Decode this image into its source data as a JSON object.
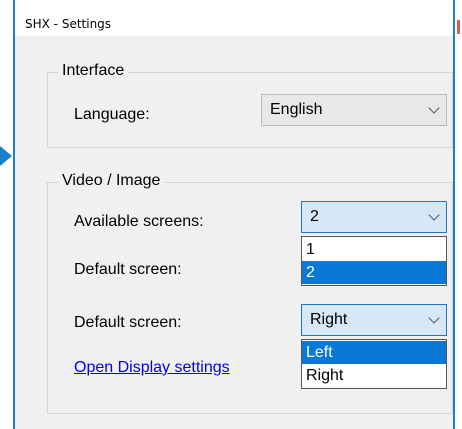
{
  "window": {
    "title": "SHX - Settings"
  },
  "interface_group": {
    "title": "Interface",
    "language_label": "Language:",
    "language_value": "English"
  },
  "video_group": {
    "title": "Video / Image",
    "available_screens_label": "Available screens:",
    "available_screens_value": "2",
    "available_screens_options": [
      "1",
      "2"
    ],
    "default_screen_label_1": "Default screen:",
    "default_screen_label_2": "Default screen:",
    "default_screen_value": "Right",
    "default_screen_options": [
      "Left",
      "Right"
    ],
    "open_display_link": "Open Display settings"
  },
  "background": {
    "colon": ":"
  },
  "colors": {
    "accent": "#1a80c8",
    "selection": "#0a78d7",
    "link": "#0000ee"
  }
}
